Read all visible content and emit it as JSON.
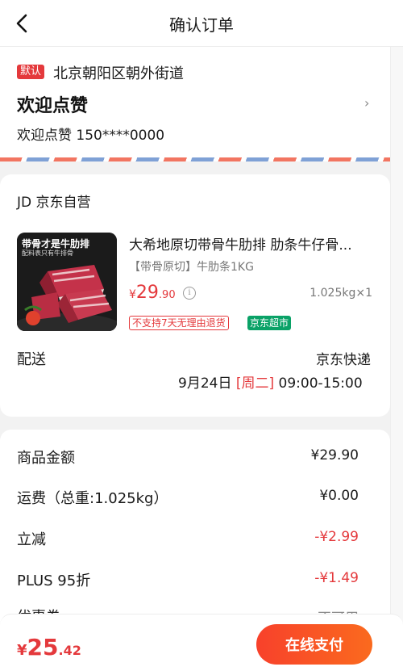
{
  "header": {
    "title": "确认订单",
    "back_icon": "chevron-left-icon"
  },
  "address": {
    "default_tag": "默认",
    "region": "北京朝阳区朝外街道",
    "name": "欢迎点赞",
    "contact": "欢迎点赞 150****0000",
    "chevron": "›"
  },
  "shop": {
    "name": "JD 京东自营",
    "product": {
      "image_caption_line1": "带骨才是牛肋排",
      "image_caption_line2": "配料表只有牛排骨",
      "title": "大希地原切带骨牛肋排 肋条牛仔骨...",
      "spec": "【带骨原切】牛肋条1KG",
      "price_symbol": "¥",
      "price_int": "29",
      "price_dec": ".90",
      "info_icon": "info-icon",
      "qty": "1.025kg×1",
      "tags": [
        "不支持7天无理由退货",
        "京东超市"
      ]
    },
    "shipping": {
      "label": "配送",
      "method": "京东快递",
      "chevron": "›",
      "date": "9月24日",
      "weekday": "[周二]",
      "time": "09:00-15:00"
    }
  },
  "summary": {
    "rows": [
      {
        "label": "商品金额",
        "value": "¥29.90"
      },
      {
        "label": "运费（总重:1.025kg）",
        "value": "¥0.00"
      },
      {
        "label": "立减",
        "value": "-¥2.99"
      },
      {
        "label": "PLUS 95折",
        "value": "-¥1.49"
      },
      {
        "label": "优惠券",
        "value": "不可用"
      }
    ]
  },
  "footer": {
    "total_symbol": "¥",
    "total_int": "25",
    "total_dec": ".42",
    "pay_label": "在线支付"
  },
  "colors": {
    "accent": "#e4393c",
    "brand_green": "#0aa267",
    "pay_gradient_start": "#f8412b",
    "pay_gradient_end": "#fa6a1e"
  }
}
